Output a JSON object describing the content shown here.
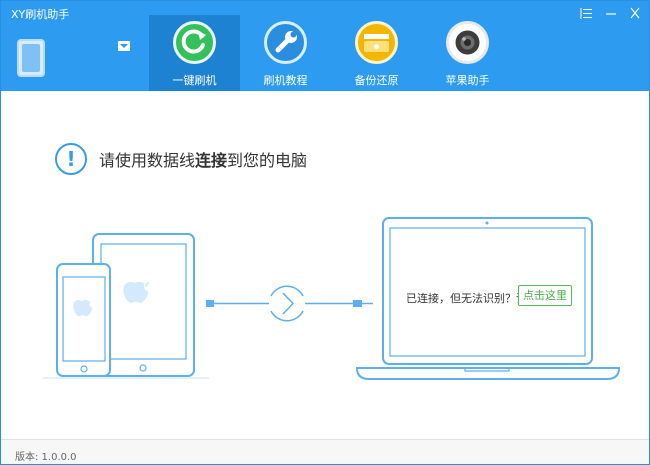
{
  "window": {
    "title": "XY刷机助手",
    "controls": [
      "menu-icon",
      "minimize-icon",
      "close-icon"
    ]
  },
  "nav": {
    "items": [
      {
        "label": "一键刷机",
        "icon": "refresh-icon",
        "color": "#34c05a",
        "active": true
      },
      {
        "label": "刷机教程",
        "icon": "wrench-icon",
        "color": "#2a8ee0",
        "active": false
      },
      {
        "label": "备份还原",
        "icon": "backup-icon",
        "color": "#f2b705",
        "active": false
      },
      {
        "label": "苹果助手",
        "icon": "camera-icon",
        "color": "#ffffff",
        "active": false
      }
    ]
  },
  "notice": {
    "prefix": "请使用数据线",
    "bold": "连接",
    "suffix": "到您的电脑"
  },
  "laptop": {
    "message": "已连接，但无法识别？请",
    "button": "点击这里"
  },
  "footer": {
    "version": "版本: 1.0.0.0"
  },
  "colors": {
    "header": "#2d9bf0",
    "active_tab": "#1e82d2",
    "illustration": "#5eaef0",
    "button_green": "#5cb85c"
  }
}
